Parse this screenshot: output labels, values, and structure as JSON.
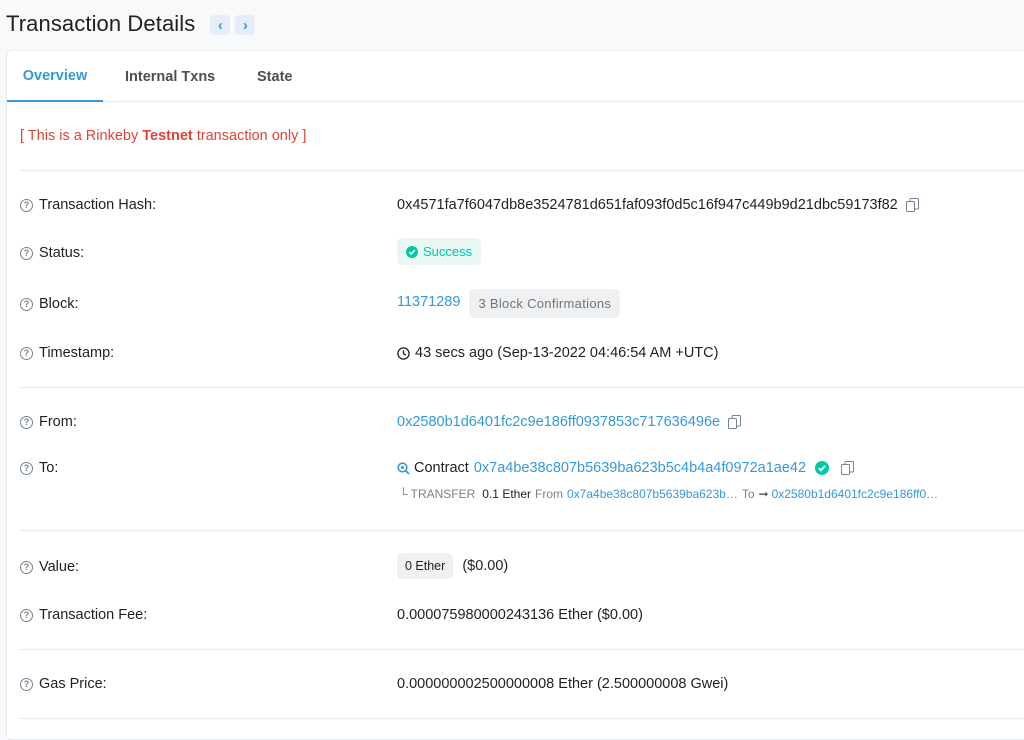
{
  "header": {
    "title": "Transaction Details",
    "prev_label": "‹",
    "next_label": "›"
  },
  "tabs": [
    {
      "label": "Overview"
    },
    {
      "label": "Internal Txns"
    },
    {
      "label": "State"
    }
  ],
  "notice": {
    "prefix": "[ This is a Rinkeby ",
    "highlight": "Testnet",
    "suffix": " transaction only ]"
  },
  "rows": {
    "hash": {
      "label": "Transaction Hash:",
      "value": "0x4571fa7f6047db8e3524781d651faf093f0d5c16f947c449b9d21dbc59173f82"
    },
    "status": {
      "label": "Status:",
      "value": "Success"
    },
    "block": {
      "label": "Block:",
      "number": "11371289",
      "confirmations": "3 Block Confirmations"
    },
    "timestamp": {
      "label": "Timestamp:",
      "value": "43 secs ago (Sep-13-2022 04:46:54 AM +UTC)"
    },
    "from": {
      "label": "From:",
      "value": "0x2580b1d6401fc2c9e186ff0937853c717636496e"
    },
    "to": {
      "label": "To:",
      "contract_label": "Contract",
      "value": "0x7a4be38c807b5639ba623b5c4b4a4f0972a1ae42",
      "transfer": {
        "prefix": "└ TRANSFER",
        "amount": "0.1 Ether",
        "from_label": "From",
        "from_value": "0x7a4be38c807b5639ba623b…",
        "to_label": "To",
        "to_value": "0x2580b1d6401fc2c9e186ff0…"
      }
    },
    "value": {
      "label": "Value:",
      "badge": "0 Ether",
      "usd": "($0.00)"
    },
    "fee": {
      "label": "Transaction Fee:",
      "value": "0.000075980000243136 Ether ($0.00)"
    },
    "gas": {
      "label": "Gas Price:",
      "value": "0.000000002500000008 Ether (2.500000008 Gwei)"
    }
  },
  "colors": {
    "accent": "#3498db",
    "success": "#00c9a7",
    "danger": "#de4437"
  }
}
